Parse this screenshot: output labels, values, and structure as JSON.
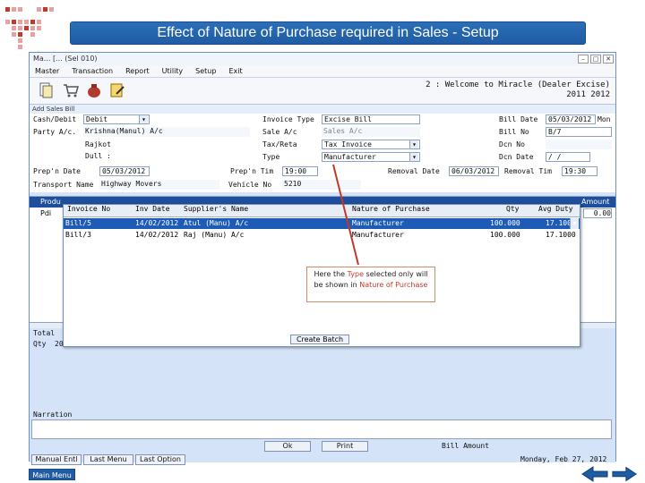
{
  "slide": {
    "title": "Effect of Nature of Purchase required in Sales - Setup",
    "main_menu_label": "Main Menu",
    "colors": {
      "title_bg": "#1f5ca3",
      "accent_red": "#c0392b",
      "selected_row": "#1e5bb6"
    }
  },
  "window": {
    "title": "Ma... [... (Sel 010)",
    "controls": [
      "–",
      "□",
      "✕"
    ],
    "menu": [
      "Master",
      "Transaction",
      "Report",
      "Utility",
      "Setup",
      "Exit"
    ],
    "toolbar_icons": [
      "document-icon",
      "cart-icon",
      "money-bag-icon",
      "notepad-icon"
    ],
    "welcome_line1": "2 : Welcome to Miracle (Dealer Excise)",
    "welcome_line2": "2011 2012"
  },
  "form": {
    "header": "Add Sales Bill",
    "cash_debit_label": "Cash/Debit",
    "cash_debit_value": "Debit",
    "party_label": "Party A/c.",
    "party_value": "Krishna(Manul) A/c",
    "city_value": "Rajkot",
    "dull_label": "Dull :",
    "invoice_type_label": "Invoice Type",
    "invoice_type_value": "Excise Bill",
    "sale_ac_label": "Sale A/c",
    "sale_ac_value": "Sales A/c",
    "tax_label": "Tax/Reta",
    "tax_value": "Tax Invoice",
    "type_label": "Type",
    "type_value": "Manufacturer",
    "bill_date_label": "Bill Date",
    "bill_date_value": "05/03/2012",
    "bill_date_suffix": "Mon",
    "bill_no_label": "Bill No",
    "bill_no_value": "B/7",
    "dcn_no_label": "Dcn No",
    "dcn_date_label": "Dcn Date",
    "dcn_date_value": "/ /",
    "prep_date_label": "Prep'n Date",
    "prep_date_value": "05/03/2012",
    "prep_time_label": "Prep'n Tim",
    "prep_time_value": "19:00",
    "removal_date_label": "Removal Date",
    "removal_date_value": "06/03/2012",
    "removal_time_label": "Removal Tim",
    "removal_time_value": "19:30",
    "transport_label": "Transport Name",
    "transport_value": "Highway Movers",
    "vehicle_label": "Vehicle No",
    "vehicle_value": "5210",
    "grid_left_headers": [
      "Produ",
      "Pdi"
    ],
    "amount_header": "Amount",
    "amount_value": "0.00",
    "total_label": "Total",
    "qty_label": "Qty",
    "qty_value": "20",
    "narration_label": "Narration",
    "buttons": [
      "Manual Entl",
      "Last Menu",
      "Last Option"
    ],
    "ok_label": "Ok",
    "print_label": "Print",
    "bill_amount_label": "Bill Amount",
    "status_date": "Monday, Feb 27, 2012"
  },
  "popup": {
    "headers": [
      "Invoice No",
      "Inv Date",
      "Supplier's Name",
      "Nature of Purchase",
      "Qty",
      "Avg Duty"
    ],
    "rows": [
      {
        "invoice": "Bill/5",
        "date": "14/02/2012",
        "supplier": "Atul (Manu) A/c",
        "nature": "Manufacturer",
        "qty": "100.000",
        "duty": "17.1000"
      },
      {
        "invoice": "Bill/3",
        "date": "14/02/2012",
        "supplier": "Raj (Manu) A/c",
        "nature": "Manufacturer",
        "qty": "100.000",
        "duty": "17.1000"
      }
    ],
    "create_batch_label": "Create Batch"
  },
  "callout": {
    "line1_pre": "Here the ",
    "line1_hl": "Type",
    "line1_post": " selected only will",
    "line2_pre": "be shown in ",
    "line2_hl": "Nature of Purchase"
  },
  "nav": {
    "back_icon": "back-arrow-icon",
    "forward_icon": "forward-arrow-icon"
  }
}
